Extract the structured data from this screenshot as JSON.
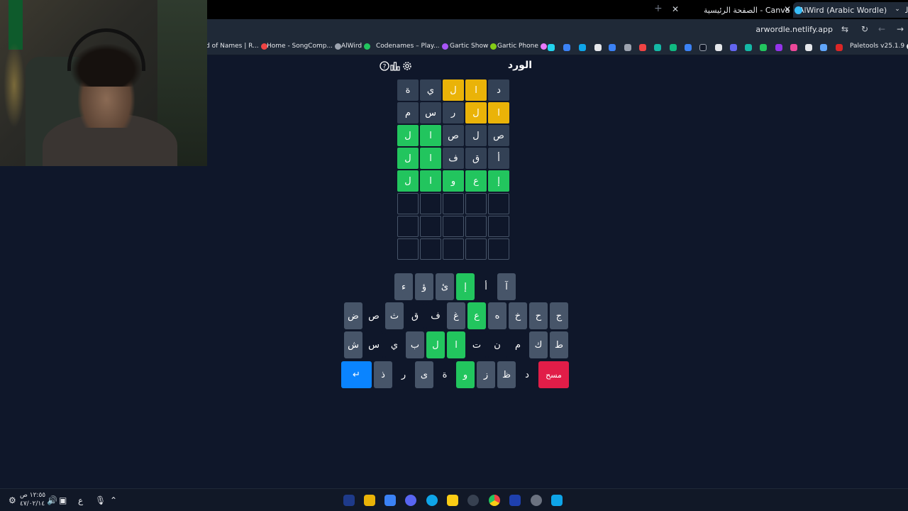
{
  "browser": {
    "tabs": [
      {
        "label": "AlWird (Arabic Wordle) - الورد",
        "active": true
      },
      {
        "label": "الصفحة الرئيسية - Canva",
        "active": false
      }
    ],
    "new_tab": "+",
    "url": "arwordle.netlify.app",
    "bookmarks": [
      {
        "label": "d of Names | R..."
      },
      {
        "label": "Home - SongComp..."
      },
      {
        "label": "AlWird"
      },
      {
        "label": "Codenames – Play..."
      },
      {
        "label": "Gartic Show"
      },
      {
        "label": "Gartic Phone"
      },
      {
        "label": "Paletools v25.1.9"
      }
    ]
  },
  "game": {
    "title": "الورد",
    "icons": [
      "help-icon",
      "stats-icon",
      "settings-icon"
    ],
    "board": [
      [
        {
          "l": "د",
          "s": "absent"
        },
        {
          "l": "ا",
          "s": "present"
        },
        {
          "l": "ل",
          "s": "present"
        },
        {
          "l": "ي",
          "s": "absent"
        },
        {
          "l": "ة",
          "s": "absent"
        }
      ],
      [
        {
          "l": "ا",
          "s": "present"
        },
        {
          "l": "ل",
          "s": "present"
        },
        {
          "l": "ر",
          "s": "absent"
        },
        {
          "l": "س",
          "s": "absent"
        },
        {
          "l": "م",
          "s": "absent"
        }
      ],
      [
        {
          "l": "ص",
          "s": "absent"
        },
        {
          "l": "ل",
          "s": "absent"
        },
        {
          "l": "ص",
          "s": "absent"
        },
        {
          "l": "ا",
          "s": "correct"
        },
        {
          "l": "ل",
          "s": "correct"
        }
      ],
      [
        {
          "l": "أ",
          "s": "absent"
        },
        {
          "l": "ق",
          "s": "absent"
        },
        {
          "l": "ف",
          "s": "absent"
        },
        {
          "l": "ا",
          "s": "correct"
        },
        {
          "l": "ل",
          "s": "correct"
        }
      ],
      [
        {
          "l": "إ",
          "s": "correct"
        },
        {
          "l": "ع",
          "s": "correct"
        },
        {
          "l": "و",
          "s": "correct"
        },
        {
          "l": "ا",
          "s": "correct"
        },
        {
          "l": "ل",
          "s": "correct"
        }
      ],
      [
        {
          "l": "",
          "s": "empty"
        },
        {
          "l": "",
          "s": "empty"
        },
        {
          "l": "",
          "s": "empty"
        },
        {
          "l": "",
          "s": "empty"
        },
        {
          "l": "",
          "s": "empty"
        }
      ],
      [
        {
          "l": "",
          "s": "empty"
        },
        {
          "l": "",
          "s": "empty"
        },
        {
          "l": "",
          "s": "empty"
        },
        {
          "l": "",
          "s": "empty"
        },
        {
          "l": "",
          "s": "empty"
        }
      ],
      [
        {
          "l": "",
          "s": "empty"
        },
        {
          "l": "",
          "s": "empty"
        },
        {
          "l": "",
          "s": "empty"
        },
        {
          "l": "",
          "s": "empty"
        },
        {
          "l": "",
          "s": "empty"
        }
      ]
    ],
    "keyboard": [
      [
        {
          "l": "آ",
          "s": "unused"
        },
        {
          "l": "أ",
          "s": "absent"
        },
        {
          "l": "إ",
          "s": "correct"
        },
        {
          "l": "ئ",
          "s": "unused"
        },
        {
          "l": "ؤ",
          "s": "unused"
        },
        {
          "l": "ء",
          "s": "unused"
        }
      ],
      [
        {
          "l": "ج",
          "s": "unused"
        },
        {
          "l": "ح",
          "s": "unused"
        },
        {
          "l": "خ",
          "s": "unused"
        },
        {
          "l": "ه",
          "s": "unused"
        },
        {
          "l": "ع",
          "s": "correct"
        },
        {
          "l": "غ",
          "s": "unused"
        },
        {
          "l": "ف",
          "s": "absent"
        },
        {
          "l": "ق",
          "s": "absent"
        },
        {
          "l": "ث",
          "s": "unused"
        },
        {
          "l": "ص",
          "s": "absent"
        },
        {
          "l": "ض",
          "s": "unused"
        }
      ],
      [
        {
          "l": "ط",
          "s": "unused"
        },
        {
          "l": "ك",
          "s": "unused"
        },
        {
          "l": "م",
          "s": "absent"
        },
        {
          "l": "ن",
          "s": "absent"
        },
        {
          "l": "ت",
          "s": "absent"
        },
        {
          "l": "ا",
          "s": "correct"
        },
        {
          "l": "ل",
          "s": "correct"
        },
        {
          "l": "ب",
          "s": "unused"
        },
        {
          "l": "ي",
          "s": "absent"
        },
        {
          "l": "س",
          "s": "absent"
        },
        {
          "l": "ش",
          "s": "unused"
        }
      ],
      [
        {
          "l": "مسح",
          "s": "delete"
        },
        {
          "l": "د",
          "s": "absent"
        },
        {
          "l": "ظ",
          "s": "unused"
        },
        {
          "l": "ز",
          "s": "unused"
        },
        {
          "l": "و",
          "s": "correct"
        },
        {
          "l": "ة",
          "s": "absent"
        },
        {
          "l": "ى",
          "s": "unused"
        },
        {
          "l": "ر",
          "s": "absent"
        },
        {
          "l": "ذ",
          "s": "unused"
        },
        {
          "l": "↵",
          "s": "enter"
        }
      ]
    ]
  },
  "taskbar": {
    "time": "١٢:٥٥ ص",
    "date": "٤٧/٠٢/١٤",
    "lang": "ع"
  },
  "colors": {
    "correct": "#22c55e",
    "present": "#eab308",
    "absent": "#334155",
    "background": "#0f172a",
    "enter": "#0a84ff",
    "delete": "#e11d48"
  }
}
